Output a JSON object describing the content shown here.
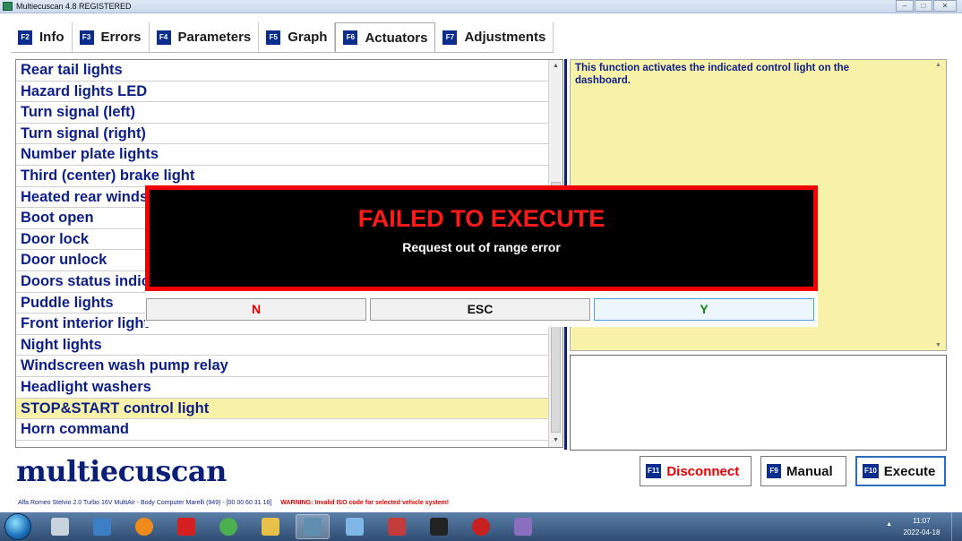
{
  "window": {
    "title": "Multiecuscan 4.8 REGISTERED",
    "controls": [
      "–",
      "□",
      "✕"
    ]
  },
  "tabs": [
    {
      "key": "F2",
      "label": "Info"
    },
    {
      "key": "F3",
      "label": "Errors"
    },
    {
      "key": "F4",
      "label": "Parameters"
    },
    {
      "key": "F5",
      "label": "Graph"
    },
    {
      "key": "F6",
      "label": "Actuators"
    },
    {
      "key": "F7",
      "label": "Adjustments"
    }
  ],
  "active_tab": "Actuators",
  "actuators": [
    "Rear tail lights",
    "Hazard lights LED",
    "Turn signal (left)",
    "Turn signal (right)",
    "Number plate lights",
    "Third (center) brake light",
    "Heated rear windscreen",
    "Boot open",
    "Door lock",
    "Door unlock",
    "Doors status indicator",
    "Puddle lights",
    "Front interior light",
    "Night lights",
    "Windscreen wash pump relay",
    "Headlight washers",
    "STOP&START control light",
    "Horn command"
  ],
  "selected_actuator": "STOP&START control light",
  "description": "This function activates the indicated control light on the dashboard.",
  "logo": "multiecuscan",
  "buttons": {
    "disconnect": {
      "key": "F11",
      "label": "Disconnect"
    },
    "manual": {
      "key": "F9",
      "label": "Manual"
    },
    "execute": {
      "key": "F10",
      "label": "Execute"
    }
  },
  "status": {
    "vehicle": "Alfa Romeo Stelvio 2.0 Turbo 16V MultiAir - Body Computer Marelli (949) - [00 00 60 31 18]",
    "warning": "WARNING: Invalid ISO code for selected vehicle system!"
  },
  "dialog": {
    "title": "FAILED TO EXECUTE",
    "message": "Request out of range error",
    "n_label": "N",
    "esc_label": "ESC",
    "y_label": "Y"
  },
  "taskbar": {
    "icons": [
      "windows-explorer-icon",
      "outlook-icon",
      "firefox-icon",
      "acrobat-icon",
      "chrome-icon",
      "folder-icon",
      "multiecuscan-icon",
      "notebook-icon",
      "toolbox-icon",
      "cmd-icon",
      "bliz-icon",
      "paint-icon"
    ],
    "time": "11:07",
    "date": "2022-04-18"
  },
  "colors": {
    "accent": "#0d1f87",
    "selected_row": "#f7f2a8",
    "error": "#f20000"
  }
}
